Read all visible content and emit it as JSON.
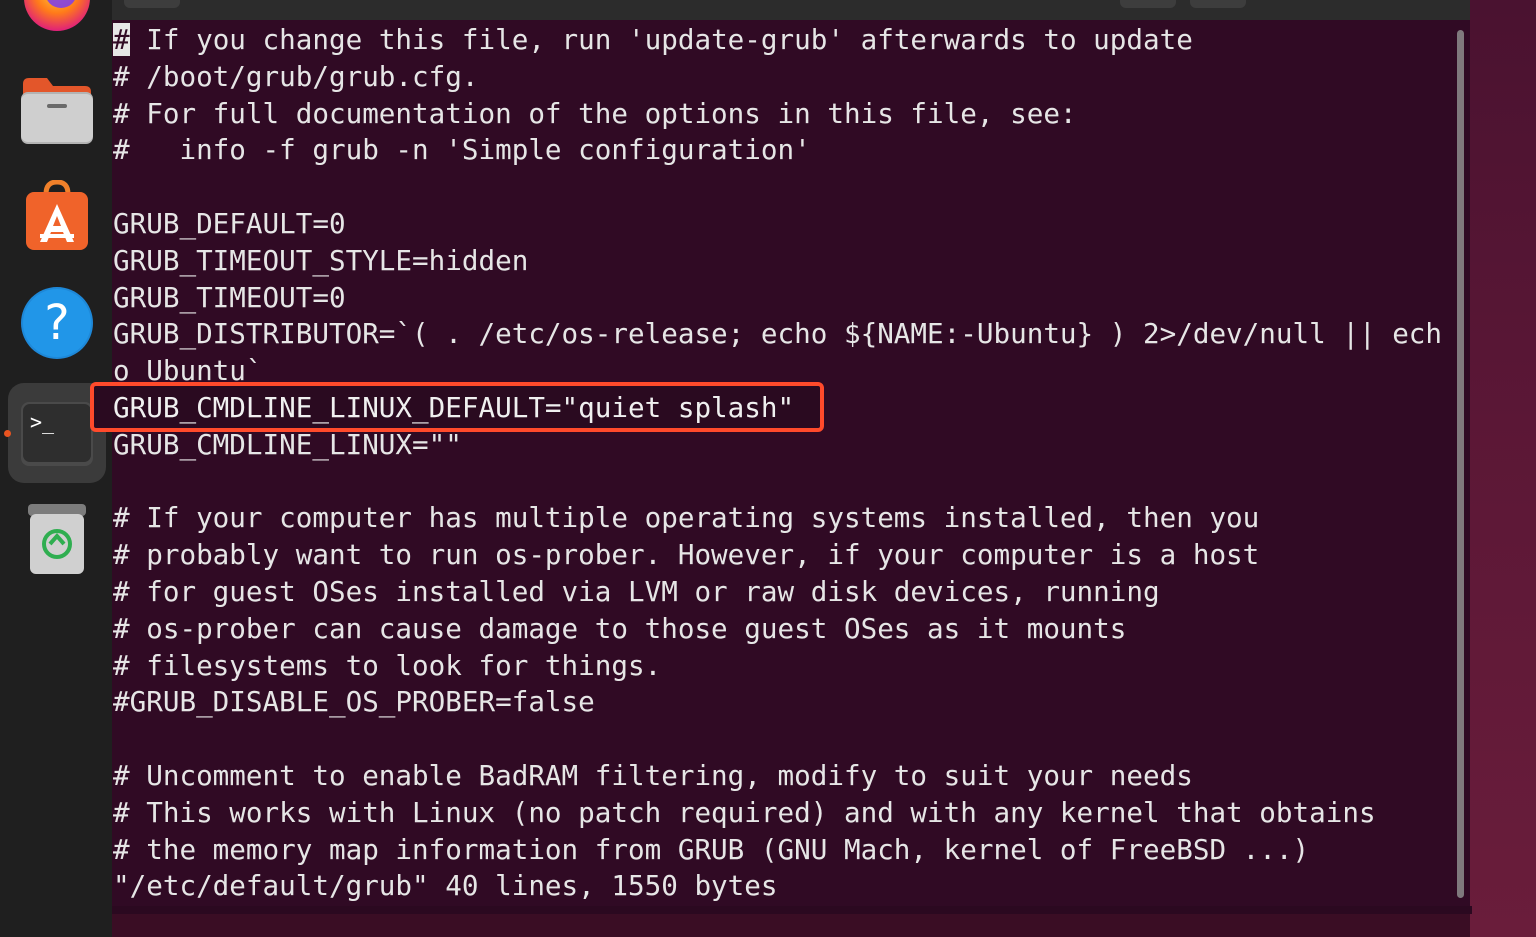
{
  "dock": {
    "items": [
      {
        "name": "firefox",
        "icon": "firefox-icon"
      },
      {
        "name": "files",
        "icon": "folder-icon"
      },
      {
        "name": "app-center",
        "icon": "app-store-icon"
      },
      {
        "name": "help",
        "icon": "help-icon",
        "glyph": "?"
      },
      {
        "name": "terminal",
        "icon": "terminal-icon",
        "glyph": ">_",
        "active": true
      },
      {
        "name": "trash",
        "icon": "trash-icon"
      }
    ]
  },
  "terminal": {
    "cursor_char": "#",
    "first_line_rest": " If you change this file, run 'update-grub' afterwards to update",
    "lines_top": [
      "# /boot/grub/grub.cfg.",
      "# For full documentation of the options in this file, see:",
      "#   info -f grub -n 'Simple configuration'",
      "",
      "GRUB_DEFAULT=0",
      "GRUB_TIMEOUT_STYLE=hidden",
      "GRUB_TIMEOUT=0",
      "GRUB_DISTRIBUTOR=`( . /etc/os-release; echo ${NAME:-Ubuntu} ) 2>/dev/null || ech",
      "o Ubuntu`",
      "",
      "GRUB_CMDLINE_LINUX=\"\"",
      "",
      "# If your computer has multiple operating systems installed, then you",
      "# probably want to run os-prober. However, if your computer is a host",
      "# for guest OSes installed via LVM or raw disk devices, running",
      "# os-prober can cause damage to those guest OSes as it mounts",
      "# filesystems to look for things.",
      "#GRUB_DISABLE_OS_PROBER=false",
      "",
      "# Uncomment to enable BadRAM filtering, modify to suit your needs",
      "# This works with Linux (no patch required) and with any kernel that obtains",
      "# the memory map information from GRUB (GNU Mach, kernel of FreeBSD ...)"
    ],
    "highlighted_line": "GRUB_CMDLINE_LINUX_DEFAULT=\"quiet splash\"",
    "status_line": "\"/etc/default/grub\" 40 lines, 1550 bytes"
  },
  "colors": {
    "terminal_bg": "#300a24",
    "text": "#e6e6e6",
    "highlight_border": "#ff4a2b",
    "dock_bg": "#1f1f1f",
    "accent": "#e95420"
  }
}
